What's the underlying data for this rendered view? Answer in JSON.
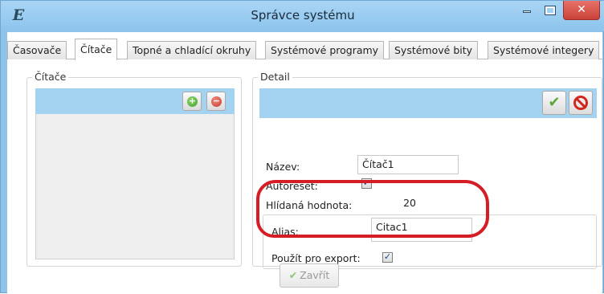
{
  "window": {
    "title": "Správce systému",
    "app_icon_glyph": "E",
    "close_glyph": "✕"
  },
  "tabs": [
    {
      "label": "Časovače",
      "active": false
    },
    {
      "label": "Čítače",
      "active": true
    },
    {
      "label": "Topné a chladící okruhy",
      "active": false
    },
    {
      "label": "Systémové programy",
      "active": false
    },
    {
      "label": "Systémové bity",
      "active": false
    },
    {
      "label": "Systémové integery",
      "active": false
    }
  ],
  "left_panel": {
    "legend": "Čítače",
    "add_icon": "+",
    "remove_icon": "−"
  },
  "detail": {
    "legend": "Detail",
    "ok_icon": "✔",
    "fields": {
      "name_label": "Název:",
      "name_value": "Čítač1",
      "autoreset_label": "Autoreset:",
      "autoreset_checked": true,
      "watched_label": "Hlídaná hodnota:",
      "watched_value": "20",
      "alias_label": "Alias:",
      "alias_value": "Citac1",
      "export_label": "Použít pro export:",
      "export_checked": true
    },
    "check_glyph": "✓"
  },
  "footer": {
    "close_label": "Zavřít",
    "close_icon": "✔"
  },
  "colors": {
    "titlebar": "#8fc4ea",
    "panel_header": "#a3d3f0",
    "annotation": "#d41d25"
  }
}
